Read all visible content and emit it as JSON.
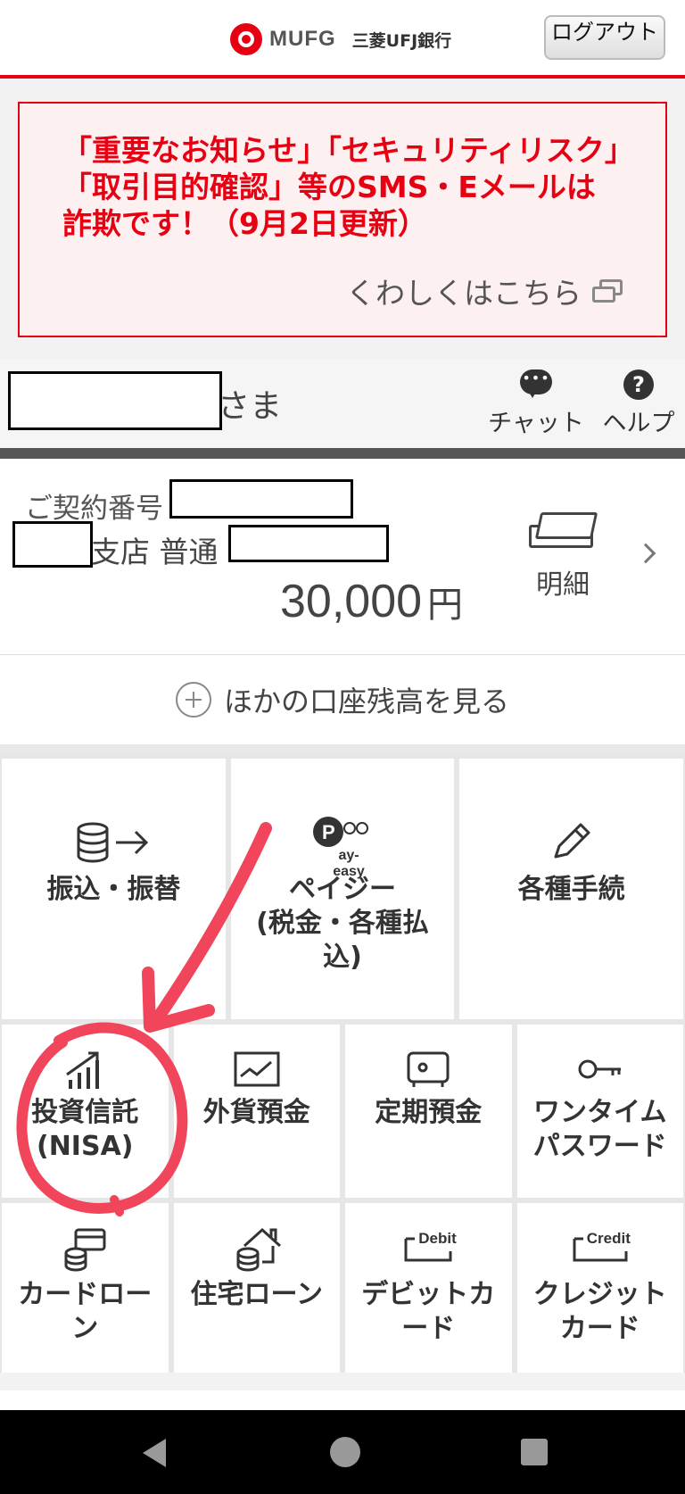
{
  "header": {
    "brand_en": "MUFG",
    "brand_jp": "三菱UFJ銀行",
    "logout_label": "ログアウト"
  },
  "notice": {
    "text": "「重要なお知らせ」「セキュリティリスク」「取引目的確認」等のSMS・Eメールは詐欺です！（9月2日更新）",
    "link_label": "くわしくはこちら"
  },
  "user": {
    "honorific": "さま",
    "chat_label": "チャット",
    "help_label": "ヘルプ"
  },
  "account": {
    "contract_label": "ご契約番号",
    "branch_label": "支店 普通",
    "balance": "30,000",
    "currency": "円",
    "detail_label": "明細"
  },
  "other_accounts_label": "ほかの口座残高を見る",
  "menu": {
    "transfer": "振込・振替",
    "payeasy_line1": "ペイジー",
    "payeasy_line2": "(税金・各種払込)",
    "payeasy_logo": "ay-easy",
    "procedures": "各種手続",
    "invest_line1": "投資信託",
    "invest_line2": "(NISA)",
    "foreign": "外貨預金",
    "time_deposit": "定期預金",
    "otp_line1": "ワンタイム",
    "otp_line2": "パスワード",
    "card_loan": "カードローン",
    "housing_loan": "住宅ローン",
    "debit_line1": "デビットカ",
    "debit_line2": "ード",
    "debit_tag": "Debit",
    "credit_line1": "クレジット",
    "credit_line2": "カード",
    "credit_tag": "Credit"
  },
  "colors": {
    "brand_red": "#e60012",
    "annotation_red": "#f0455a"
  }
}
